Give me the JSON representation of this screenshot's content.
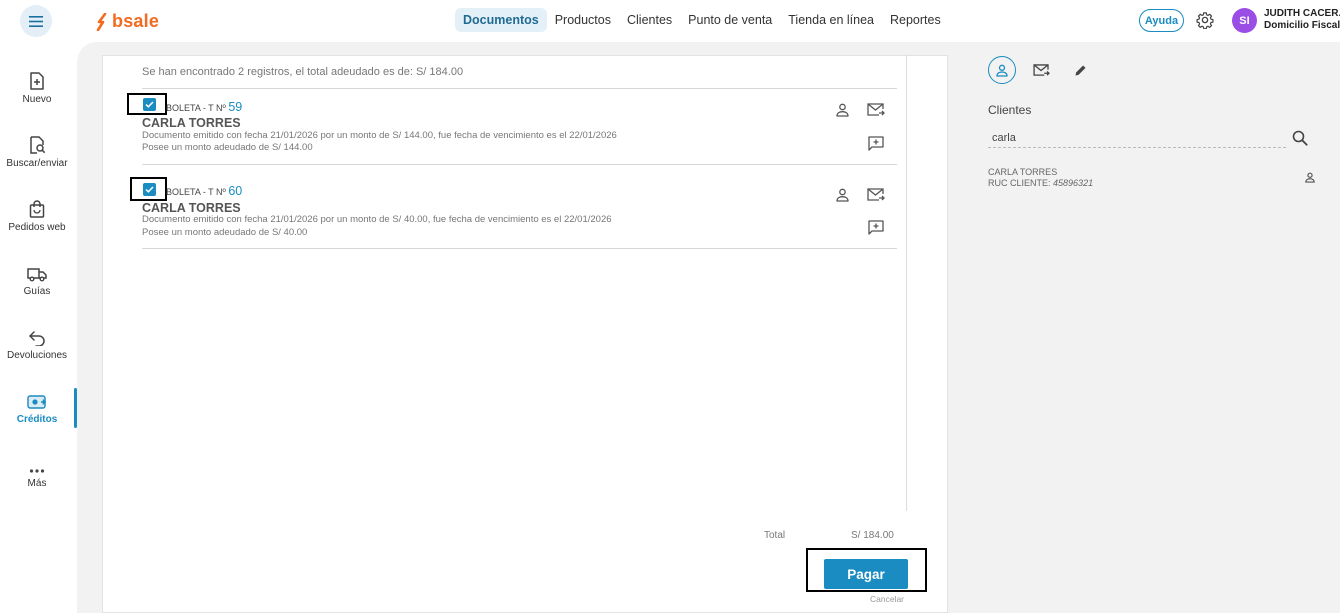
{
  "app": {
    "logo_text": "bsale",
    "brand_color": "#f26b21",
    "accent_color": "#1a8cc1"
  },
  "topnav": {
    "items": [
      {
        "label": "Documentos",
        "active": true
      },
      {
        "label": "Productos"
      },
      {
        "label": "Clientes"
      },
      {
        "label": "Punto de venta"
      },
      {
        "label": "Tienda en línea"
      },
      {
        "label": "Reportes"
      }
    ],
    "help_label": "Ayuda",
    "user_initials": "SI",
    "user_name": "JUDITH CACER...",
    "user_subtitle": "Domicilio Fiscal"
  },
  "sidebar": {
    "items": [
      {
        "label": "Nuevo",
        "icon": "new-document-icon"
      },
      {
        "label": "Buscar/enviar",
        "icon": "search-document-icon"
      },
      {
        "label": "Pedidos web",
        "icon": "shopping-bag-icon"
      },
      {
        "label": "Guías",
        "icon": "truck-icon"
      },
      {
        "label": "Devoluciones",
        "icon": "return-arrow-icon"
      },
      {
        "label": "Créditos",
        "icon": "credit-money-icon",
        "active": true
      },
      {
        "label": "Más",
        "icon": "more-dots-icon"
      }
    ]
  },
  "documents": {
    "summary": "Se han encontrado 2 registros, el total adeudado es de: S/ 184.00",
    "rows": [
      {
        "checked": true,
        "type": "BOLETA - T Nº",
        "number": "59",
        "client": "CARLA TORRES",
        "description": "Documento emitido con fecha 21/01/2026 por un monto de S/ 144.00, fue fecha de vencimiento es el 22/01/2026",
        "debt": "Posee un monto adeudado de S/ 144.00"
      },
      {
        "checked": true,
        "type": "BOLETA - T Nº",
        "number": "60",
        "client": "CARLA TORRES",
        "description": "Documento emitido con fecha 21/01/2026 por un monto de S/ 40.00, fue fecha de vencimiento es el 22/01/2026",
        "debt": "Posee un monto adeudado de S/ 40.00"
      }
    ],
    "total_label": "Total",
    "total_value": "S/ 184.00",
    "pay_label": "Pagar",
    "cancel_label": "Cancelar"
  },
  "right_panel": {
    "tabs": [
      "client-tab",
      "email-tab",
      "edit-tab"
    ],
    "clients_title": "Clientes",
    "search_value": "carla",
    "result": {
      "name": "CARLA TORRES",
      "ruc_label": "RUC CLIENTE:",
      "ruc_value": "45896321"
    }
  }
}
